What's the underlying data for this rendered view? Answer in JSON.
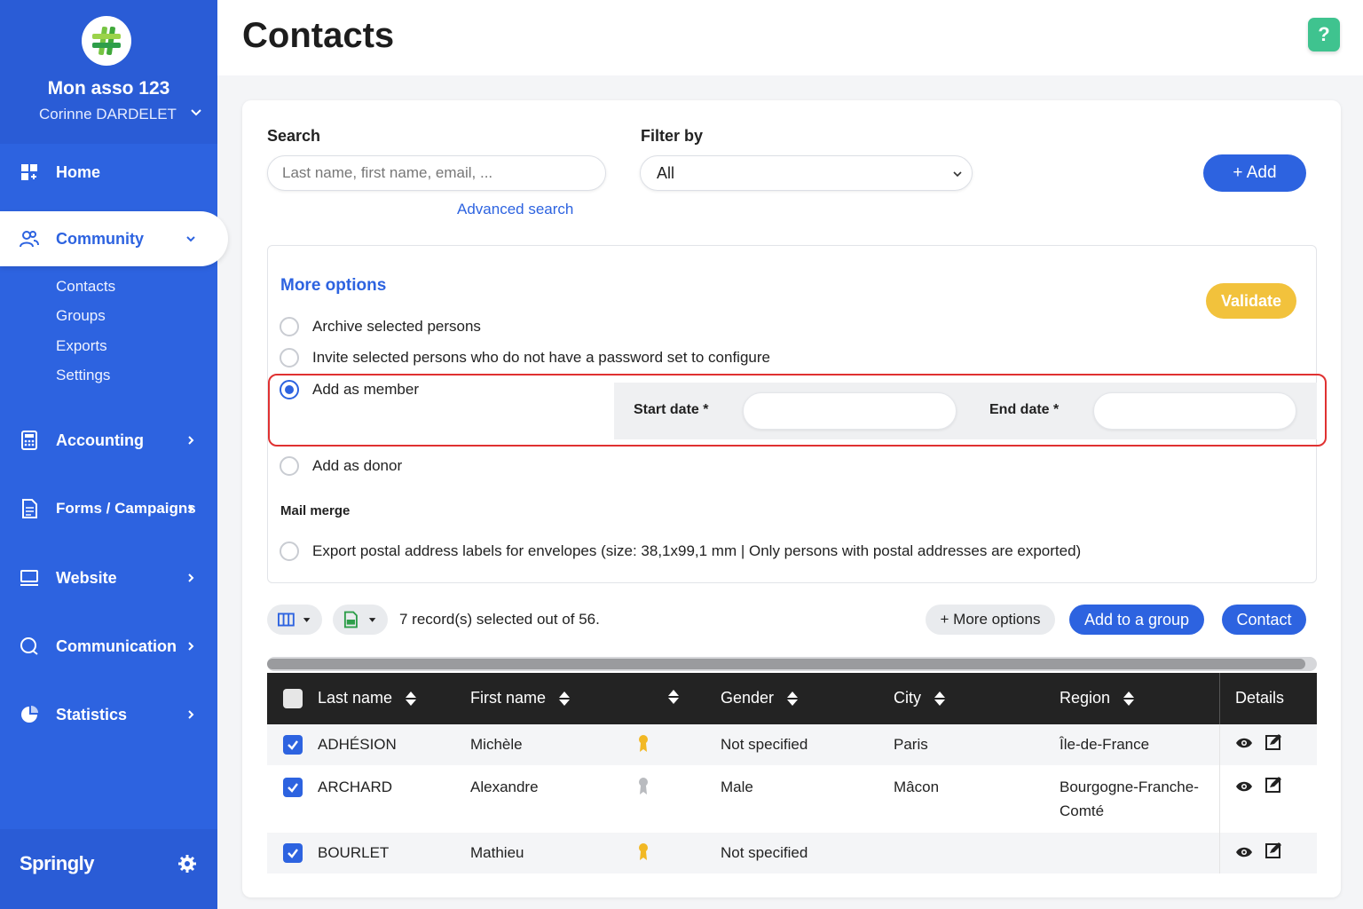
{
  "sidebar": {
    "org_name": "Mon asso 123",
    "user_name": "Corinne DARDELET",
    "nav": {
      "home": "Home",
      "community": "Community",
      "accounting": "Accounting",
      "forms": "Forms / Campaigns",
      "website": "Website",
      "communication": "Communication",
      "statistics": "Statistics"
    },
    "community_sub": [
      "Contacts",
      "Groups",
      "Exports",
      "Settings"
    ],
    "brand": "Springly"
  },
  "header": {
    "title": "Contacts",
    "help": "?"
  },
  "search": {
    "label": "Search",
    "placeholder": "Last name, first name, email, ...",
    "advanced": "Advanced search"
  },
  "filter": {
    "label": "Filter by",
    "value": "All"
  },
  "add_button": "+ Add",
  "more_options": {
    "title": "More options",
    "validate": "Validate",
    "options": {
      "archive": "Archive selected persons",
      "invite": "Invite selected persons who do not have a password set to configure",
      "member": "Add as member",
      "donor": "Add as donor",
      "labels": "Export postal address labels for envelopes (size: 38,1x99,1 mm | Only persons with postal addresses are exported)"
    },
    "selected": "member",
    "start_date_label": "Start date *",
    "end_date_label": "End date *",
    "mail_merge": "Mail merge"
  },
  "toolbar": {
    "selection_text": "7 record(s) selected out of 56.",
    "more_options": "+ More options",
    "add_to_group": "Add to a group",
    "contact": "Contact"
  },
  "table": {
    "headers": {
      "last_name": "Last name",
      "first_name": "First name",
      "gender": "Gender",
      "city": "City",
      "region": "Region",
      "details": "Details"
    },
    "rows": [
      {
        "last_name": "ADHÉSION",
        "first_name": "Michèle",
        "badge": "gold",
        "gender": "Not specified",
        "city": "Paris",
        "region": "Île-de-France",
        "checked": true
      },
      {
        "last_name": "ARCHARD",
        "first_name": "Alexandre",
        "badge": "grey",
        "gender": "Male",
        "city": "Mâcon",
        "region": "Bourgogne-Franche-Comté",
        "checked": true
      },
      {
        "last_name": "BOURLET",
        "first_name": "Mathieu",
        "badge": "gold",
        "gender": "Not specified",
        "city": "",
        "region": "",
        "checked": true
      }
    ]
  },
  "colors": {
    "sidebar": "#2d63e0",
    "accent": "#2d63e0",
    "validate": "#f2c23c",
    "help": "#3fc38f",
    "highlight": "#e03131",
    "table_header": "#232323"
  }
}
